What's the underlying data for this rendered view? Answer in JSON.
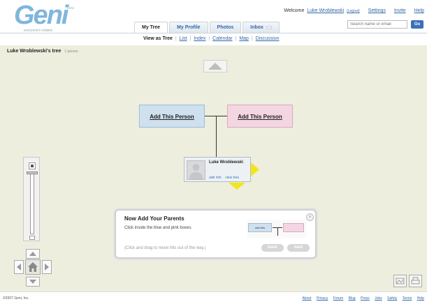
{
  "logo": {
    "word": "Geni",
    "beta": "beta",
    "tagline": "everyone's related"
  },
  "topnav": {
    "welcome_prefix": "Welcome",
    "username": "Luke Wroblewski",
    "logout": "(Logout)",
    "settings": "Settings",
    "invite": "Invite",
    "help": "Help"
  },
  "search": {
    "placeholder": "Search name or email",
    "go_label": "Go"
  },
  "tabs": [
    {
      "label": "My Tree"
    },
    {
      "label": "My Profile"
    },
    {
      "label": "Photos"
    },
    {
      "label": "Inbox"
    }
  ],
  "subnav": {
    "prefix": "View as",
    "current": "Tree",
    "items": [
      "List",
      "Index",
      "Calendar",
      "Map",
      "Discussion"
    ]
  },
  "tree": {
    "title": "Luke Wroblewski's tree",
    "count": "1 person"
  },
  "add_father": {
    "label": "Add This Person"
  },
  "add_mother": {
    "label": "Add This Person"
  },
  "person": {
    "name": "Luke Wroblewski",
    "links": [
      "add info",
      "view tree"
    ]
  },
  "popup": {
    "title": "Now Add Your Parents",
    "description": "Click inside the blue and pink boxes.",
    "hint": "(Click and drag to move this out of the way.)",
    "back_label": "back",
    "next_label": "next",
    "illus_label": "add this"
  },
  "footer": {
    "copyright": "©2007 Geni, Inc.",
    "links": [
      "About",
      "Privacy",
      "Forum",
      "Blog",
      "Press",
      "Jobs",
      "Safety",
      "Terms",
      "Help"
    ]
  },
  "colors": {
    "canvas_bg": "#edeedd",
    "father_box": "#cfe0ee",
    "mother_box": "#f3d6e2",
    "accent_yellow": "#f2e51a",
    "link": "#3366aa",
    "brand_blue": "#7fb6dc"
  },
  "icons": {
    "up": "triangle-up-icon",
    "pan_home": "home-icon",
    "close": "close-icon"
  }
}
